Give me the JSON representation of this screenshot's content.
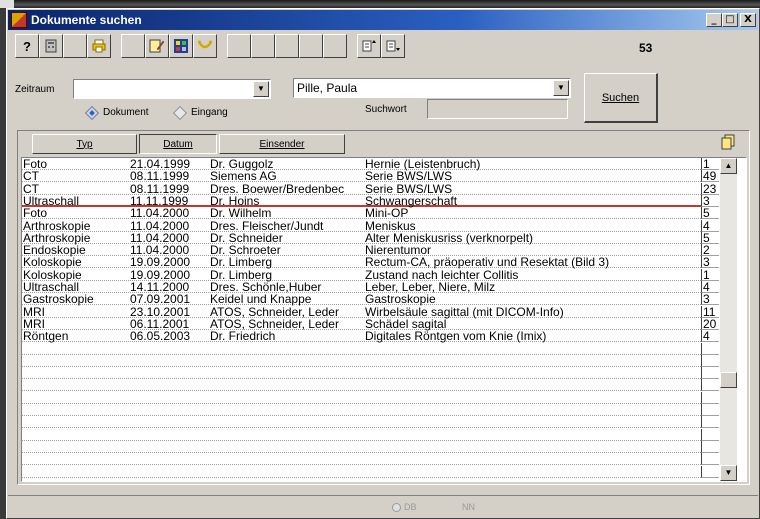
{
  "window": {
    "title": "Dokumente suchen",
    "minimize": "_",
    "maximize": "□",
    "close": "X"
  },
  "toolbar": {
    "help_label": "?",
    "record_count": "53"
  },
  "filters": {
    "zeitraum_label": "Zeitraum",
    "zeitraum_value": "",
    "patient_value": "Pille, Paula",
    "suchwort_label": "Suchwort",
    "suchwort_value": "",
    "search_button": "Suchen",
    "radio_dokument": "Dokument",
    "radio_eingang": "Eingang",
    "selected_radio": "Dokument"
  },
  "sort_buttons": {
    "typ": "Typ",
    "datum": "Datum",
    "einsender": "Einsender",
    "pressed": "datum"
  },
  "documents": [
    {
      "typ": "Foto",
      "datum": "21.04.1999",
      "einsender": "Dr. Guggolz",
      "beschreibung": "Hernie (Leistenbruch)",
      "n": "1"
    },
    {
      "typ": "CT",
      "datum": "08.11.1999",
      "einsender": "Siemens AG",
      "beschreibung": "Serie BWS/LWS",
      "n": "49"
    },
    {
      "typ": "CT",
      "datum": "08.11.1999",
      "einsender": "Dres. Boewer/Bredenbec",
      "beschreibung": "Serie BWS/LWS",
      "n": "23"
    },
    {
      "typ": "Ultraschall",
      "datum": "11.11.1999",
      "einsender": "Dr. Hoins",
      "beschreibung": "Schwangerschaft",
      "n": "3"
    },
    {
      "typ": "Foto",
      "datum": "11.04.2000",
      "einsender": "Dr. Wilhelm",
      "beschreibung": "Mini-OP",
      "n": "5"
    },
    {
      "typ": "Arthroskopie",
      "datum": "11.04.2000",
      "einsender": "Dres. Fleischer/Jundt",
      "beschreibung": "Meniskus",
      "n": "4"
    },
    {
      "typ": "Arthroskopie",
      "datum": "11.04.2000",
      "einsender": "Dr. Schneider",
      "beschreibung": "Alter Meniskusriss (verknorpelt)",
      "n": "5"
    },
    {
      "typ": "Endoskopie",
      "datum": "11.04.2000",
      "einsender": "Dr. Schroeter",
      "beschreibung": "Nierentumor",
      "n": "2"
    },
    {
      "typ": "Koloskopie",
      "datum": "19.09.2000",
      "einsender": "Dr. Limberg",
      "beschreibung": "Rectum-CA, präoperativ und Resektat (Bild 3)",
      "n": "3"
    },
    {
      "typ": "Koloskopie",
      "datum": "19.09.2000",
      "einsender": "Dr. Limberg",
      "beschreibung": "Zustand nach leichter Collitis",
      "n": "1"
    },
    {
      "typ": "Ultraschall",
      "datum": "14.11.2000",
      "einsender": "Dres. Schönle,Huber",
      "beschreibung": "Leber, Leber, Niere, Milz",
      "n": "4"
    },
    {
      "typ": "Gastroskopie",
      "datum": "07.09.2001",
      "einsender": "Keidel und Knappe",
      "beschreibung": "Gastroskopie",
      "n": "3"
    },
    {
      "typ": "MRI",
      "datum": "23.10.2001",
      "einsender": "ATOS, Schneider, Leder",
      "beschreibung": "Wirbelsäule sagittal (mit DICOM-Info)",
      "n": "11"
    },
    {
      "typ": "MRI",
      "datum": "06.11.2001",
      "einsender": "ATOS, Schneider, Leder",
      "beschreibung": "Schädel sagital",
      "n": "20"
    },
    {
      "typ": "Röntgen",
      "datum": "06.05.2003",
      "einsender": "Dr. Friedrich",
      "beschreibung": "Digitales Röntgen vom Knie (Imix)",
      "n": "4"
    }
  ],
  "statusbar": {
    "db": "DB",
    "nn": "NN"
  },
  "colors": {
    "title_start": "#0a246a",
    "title_end": "#a6caf0",
    "window_face": "#d4d0c8",
    "separator_red": "#c0392b"
  }
}
